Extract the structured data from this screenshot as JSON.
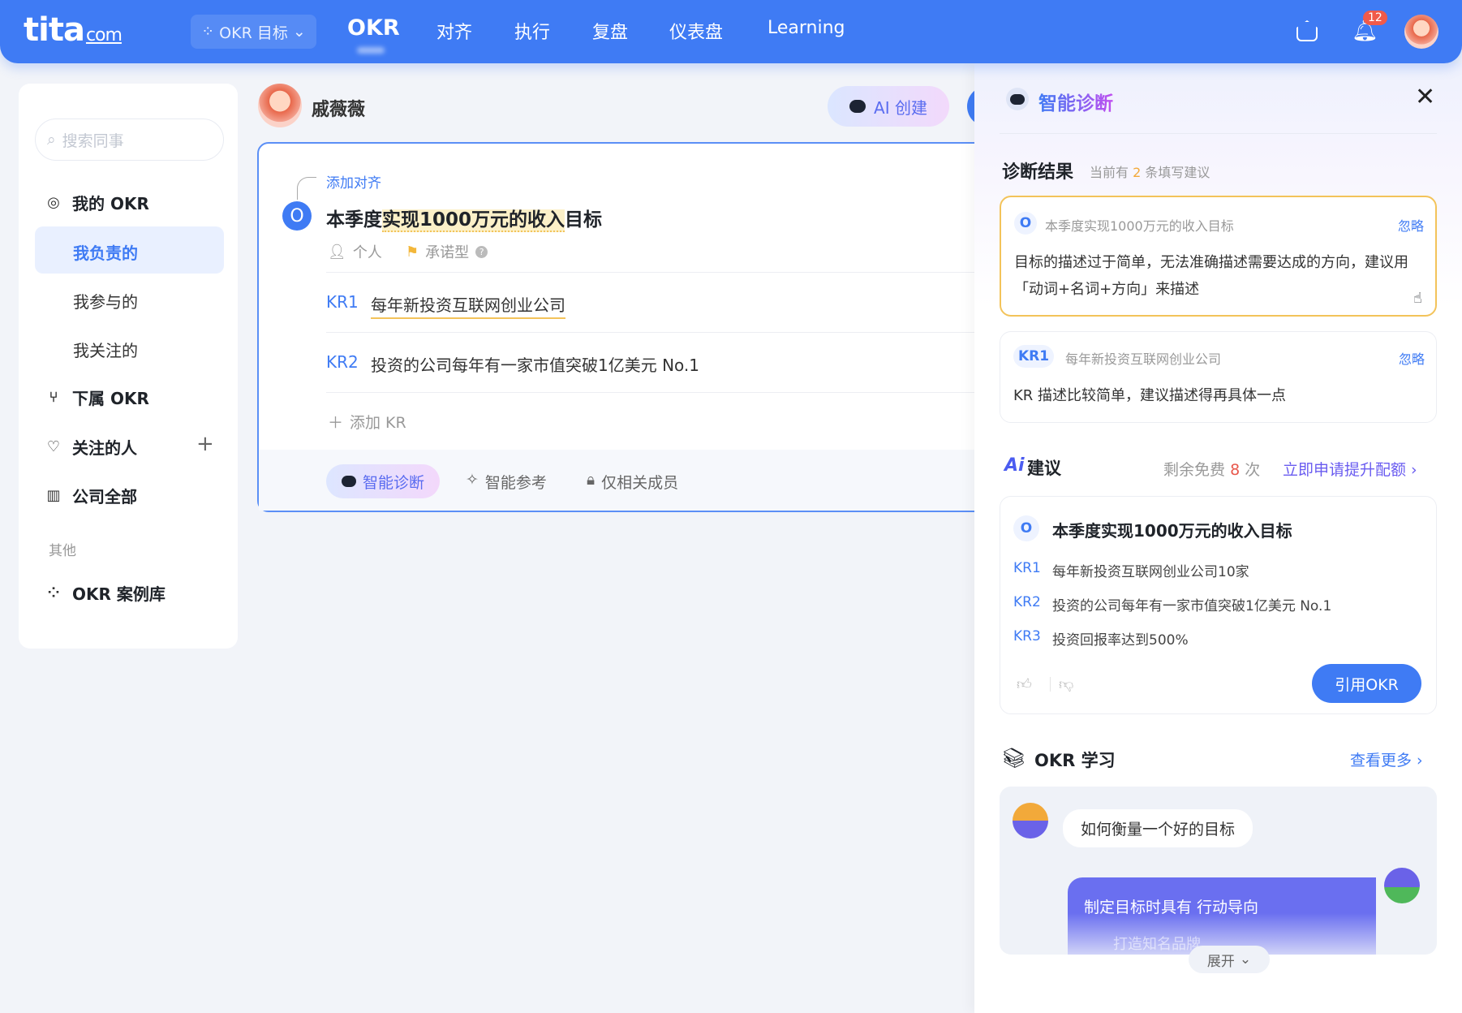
{
  "topbar": {
    "logo": "tita",
    "logo_suffix": "com",
    "dropdown": "OKR 目标",
    "nav": [
      "OKR",
      "对齐",
      "执行",
      "复盘",
      "仪表盘",
      "Learning"
    ],
    "notification_count": "12"
  },
  "sidebar": {
    "search_placeholder": "搜索同事",
    "items": [
      {
        "label": "我的 OKR",
        "icon": "target-icon"
      },
      {
        "label": "我负责的"
      },
      {
        "label": "我参与的"
      },
      {
        "label": "我关注的"
      },
      {
        "label": "下属 OKR",
        "icon": "tree-icon"
      },
      {
        "label": "关注的人",
        "icon": "heart-icon"
      },
      {
        "label": "公司全部",
        "icon": "building-icon"
      }
    ],
    "section_other": "其他",
    "case_library": "OKR 案例库",
    "add": "+"
  },
  "main": {
    "user_name": "戚薇薇",
    "ai_create": "AI 创建",
    "add_alignment": "添加对齐",
    "objective": {
      "badge": "O",
      "pre": "本季度",
      "highlight": "实现1000万元的收入",
      "post": "目标"
    },
    "meta": {
      "type": "个人",
      "category": "承诺型"
    },
    "krs": [
      {
        "label": "KR1",
        "text": "每年新投资互联网创业公司"
      },
      {
        "label": "KR2",
        "text": "投资的公司每年有一家市值突破1亿美元 No.1"
      }
    ],
    "add_kr": "添加 KR",
    "footer": {
      "diagnosis": "智能诊断",
      "reference": "智能参考",
      "visibility": "仅相关成员"
    }
  },
  "panel": {
    "title": "智能诊断",
    "result_title": "诊断结果",
    "result_pre": "当前有",
    "result_count": "2",
    "result_post": "条填写建议",
    "cards": [
      {
        "badge": "O",
        "target": "本季度实现1000万元的收入目标",
        "ignore": "忽略",
        "text": "目标的描述过于简单，无法准确描述需要达成的方向，建议用「动词+名词+方向」来描述"
      },
      {
        "badge": "KR1",
        "target": "每年新投资互联网创业公司",
        "ignore": "忽略",
        "text": "KR 描述比较简单，建议描述得再具体一点"
      }
    ],
    "ai": {
      "logo": "Ai",
      "title": "建议",
      "remain_pre": "剩余免费",
      "remain_count": "8",
      "remain_post": "次",
      "upgrade": "立即申请提升配额 ›",
      "badge": "O",
      "objective": "本季度实现1000万元的收入目标",
      "krs": [
        {
          "label": "KR1",
          "text": "每年新投资互联网创业公司10家"
        },
        {
          "label": "KR2",
          "text": "投资的公司每年有一家市值突破1亿美元 No.1"
        },
        {
          "label": "KR3",
          "text": "投资回报率达到500%"
        }
      ],
      "cite": "引用OKR"
    },
    "learn": {
      "title": "OKR 学习",
      "more": "查看更多 ›",
      "question": "如何衡量一个好的目标",
      "answer": "制定目标时具有 行动导向",
      "answer_faded": "打造知名品牌",
      "expand": "展开"
    }
  },
  "colors": {
    "primary": "#3f7bf4",
    "highlight": "#fbf0c8",
    "warning_border": "#f3c35a",
    "badge_red": "#f05a4a"
  }
}
